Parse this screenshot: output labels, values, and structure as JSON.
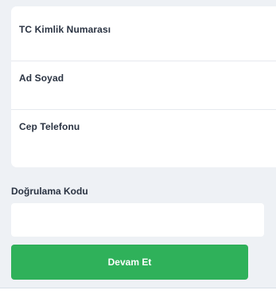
{
  "form": {
    "fields": [
      {
        "label": "TC Kimlik Numarası",
        "value": "",
        "placeholder": ""
      },
      {
        "label": "Ad Soyad",
        "value": "",
        "placeholder": ""
      },
      {
        "label": "Cep Telefonu",
        "value": "",
        "placeholder": ""
      }
    ]
  },
  "verification": {
    "label": "Doğrulama Kodu",
    "value": "",
    "placeholder": ""
  },
  "actions": {
    "submit_label": "Devam Et"
  },
  "colors": {
    "background": "#eef1f5",
    "card": "#ffffff",
    "text": "#2a3342",
    "primary": "#2fb15a"
  }
}
